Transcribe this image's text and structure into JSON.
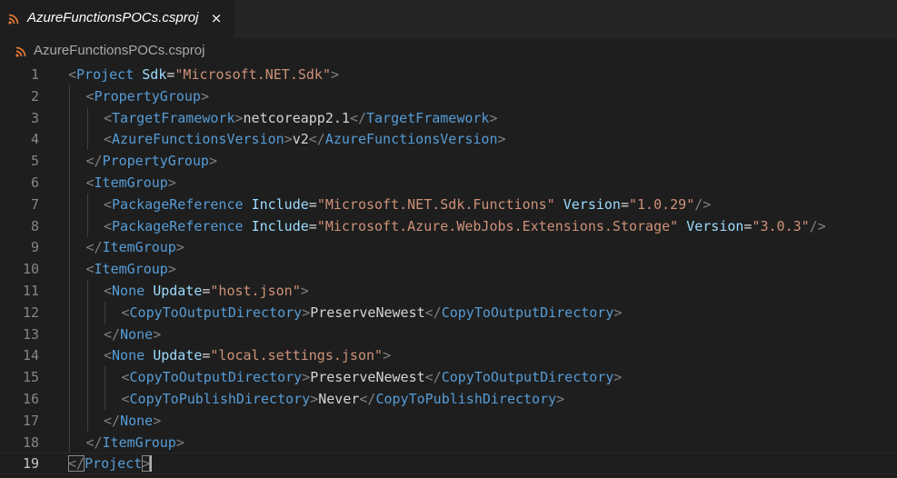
{
  "tab": {
    "title": "AzureFunctionsPOCs.csproj",
    "close_glyph": "×",
    "icon": "rss-icon",
    "icon_color": "#e37933"
  },
  "breadcrumb": {
    "label": "AzureFunctionsPOCs.csproj",
    "icon": "rss-icon"
  },
  "colors": {
    "tag": "#569cd6",
    "punctuation": "#808080",
    "attribute": "#9cdcfe",
    "string": "#ce9178",
    "text": "#d4d4d4",
    "line_number": "#858585",
    "background": "#1e1e1e"
  },
  "editor": {
    "current_line": 19,
    "lines": [
      {
        "number": "1",
        "indent": 0,
        "tokens": [
          [
            "p",
            "<"
          ],
          [
            "t",
            "Project"
          ],
          [
            "x",
            " "
          ],
          [
            "a",
            "Sdk"
          ],
          [
            "x",
            "="
          ],
          [
            "s",
            "\"Microsoft.NET.Sdk\""
          ],
          [
            "p",
            ">"
          ]
        ]
      },
      {
        "number": "2",
        "indent": 1,
        "tokens": [
          [
            "p",
            "<"
          ],
          [
            "t",
            "PropertyGroup"
          ],
          [
            "p",
            ">"
          ]
        ]
      },
      {
        "number": "3",
        "indent": 2,
        "tokens": [
          [
            "p",
            "<"
          ],
          [
            "t",
            "TargetFramework"
          ],
          [
            "p",
            ">"
          ],
          [
            "x",
            "netcoreapp2.1"
          ],
          [
            "p",
            "</"
          ],
          [
            "t",
            "TargetFramework"
          ],
          [
            "p",
            ">"
          ]
        ]
      },
      {
        "number": "4",
        "indent": 2,
        "tokens": [
          [
            "p",
            "<"
          ],
          [
            "t",
            "AzureFunctionsVersion"
          ],
          [
            "p",
            ">"
          ],
          [
            "x",
            "v2"
          ],
          [
            "p",
            "</"
          ],
          [
            "t",
            "AzureFunctionsVersion"
          ],
          [
            "p",
            ">"
          ]
        ]
      },
      {
        "number": "5",
        "indent": 1,
        "tokens": [
          [
            "p",
            "</"
          ],
          [
            "t",
            "PropertyGroup"
          ],
          [
            "p",
            ">"
          ]
        ]
      },
      {
        "number": "6",
        "indent": 1,
        "tokens": [
          [
            "p",
            "<"
          ],
          [
            "t",
            "ItemGroup"
          ],
          [
            "p",
            ">"
          ]
        ]
      },
      {
        "number": "7",
        "indent": 2,
        "tokens": [
          [
            "p",
            "<"
          ],
          [
            "t",
            "PackageReference"
          ],
          [
            "x",
            " "
          ],
          [
            "a",
            "Include"
          ],
          [
            "x",
            "="
          ],
          [
            "s",
            "\"Microsoft.NET.Sdk.Functions\""
          ],
          [
            "x",
            " "
          ],
          [
            "a",
            "Version"
          ],
          [
            "x",
            "="
          ],
          [
            "s",
            "\"1.0.29\""
          ],
          [
            "p",
            "/>"
          ]
        ]
      },
      {
        "number": "8",
        "indent": 2,
        "tokens": [
          [
            "p",
            "<"
          ],
          [
            "t",
            "PackageReference"
          ],
          [
            "x",
            " "
          ],
          [
            "a",
            "Include"
          ],
          [
            "x",
            "="
          ],
          [
            "s",
            "\"Microsoft.Azure.WebJobs.Extensions.Storage\""
          ],
          [
            "x",
            " "
          ],
          [
            "a",
            "Version"
          ],
          [
            "x",
            "="
          ],
          [
            "s",
            "\"3.0.3\""
          ],
          [
            "p",
            "/>"
          ]
        ]
      },
      {
        "number": "9",
        "indent": 1,
        "tokens": [
          [
            "p",
            "</"
          ],
          [
            "t",
            "ItemGroup"
          ],
          [
            "p",
            ">"
          ]
        ]
      },
      {
        "number": "10",
        "indent": 1,
        "tokens": [
          [
            "p",
            "<"
          ],
          [
            "t",
            "ItemGroup"
          ],
          [
            "p",
            ">"
          ]
        ]
      },
      {
        "number": "11",
        "indent": 2,
        "tokens": [
          [
            "p",
            "<"
          ],
          [
            "t",
            "None"
          ],
          [
            "x",
            " "
          ],
          [
            "a",
            "Update"
          ],
          [
            "x",
            "="
          ],
          [
            "s",
            "\"host.json\""
          ],
          [
            "p",
            ">"
          ]
        ]
      },
      {
        "number": "12",
        "indent": 3,
        "tokens": [
          [
            "p",
            "<"
          ],
          [
            "t",
            "CopyToOutputDirectory"
          ],
          [
            "p",
            ">"
          ],
          [
            "x",
            "PreserveNewest"
          ],
          [
            "p",
            "</"
          ],
          [
            "t",
            "CopyToOutputDirectory"
          ],
          [
            "p",
            ">"
          ]
        ]
      },
      {
        "number": "13",
        "indent": 2,
        "tokens": [
          [
            "p",
            "</"
          ],
          [
            "t",
            "None"
          ],
          [
            "p",
            ">"
          ]
        ]
      },
      {
        "number": "14",
        "indent": 2,
        "tokens": [
          [
            "p",
            "<"
          ],
          [
            "t",
            "None"
          ],
          [
            "x",
            " "
          ],
          [
            "a",
            "Update"
          ],
          [
            "x",
            "="
          ],
          [
            "s",
            "\"local.settings.json\""
          ],
          [
            "p",
            ">"
          ]
        ]
      },
      {
        "number": "15",
        "indent": 3,
        "tokens": [
          [
            "p",
            "<"
          ],
          [
            "t",
            "CopyToOutputDirectory"
          ],
          [
            "p",
            ">"
          ],
          [
            "x",
            "PreserveNewest"
          ],
          [
            "p",
            "</"
          ],
          [
            "t",
            "CopyToOutputDirectory"
          ],
          [
            "p",
            ">"
          ]
        ]
      },
      {
        "number": "16",
        "indent": 3,
        "tokens": [
          [
            "p",
            "<"
          ],
          [
            "t",
            "CopyToPublishDirectory"
          ],
          [
            "p",
            ">"
          ],
          [
            "x",
            "Never"
          ],
          [
            "p",
            "</"
          ],
          [
            "t",
            "CopyToPublishDirectory"
          ],
          [
            "p",
            ">"
          ]
        ]
      },
      {
        "number": "17",
        "indent": 2,
        "tokens": [
          [
            "p",
            "</"
          ],
          [
            "t",
            "None"
          ],
          [
            "p",
            ">"
          ]
        ]
      },
      {
        "number": "18",
        "indent": 1,
        "tokens": [
          [
            "p",
            "</"
          ],
          [
            "t",
            "ItemGroup"
          ],
          [
            "p",
            ">"
          ]
        ]
      },
      {
        "number": "19",
        "indent": 0,
        "tokens": [
          [
            "p",
            "</"
          ],
          [
            "t",
            "Project"
          ],
          [
            "p",
            ">"
          ]
        ]
      }
    ]
  }
}
